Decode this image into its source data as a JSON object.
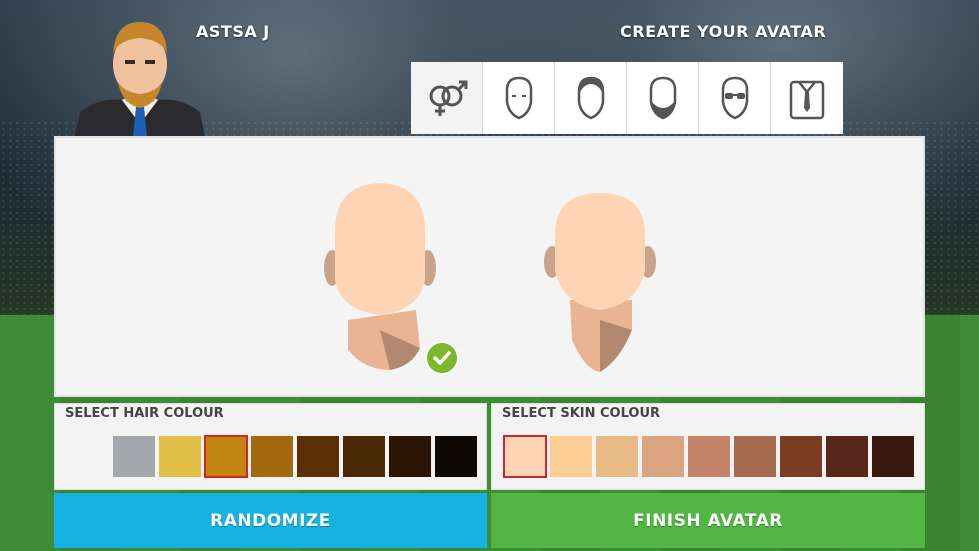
{
  "header": {
    "player_name": "ASTSA J",
    "title": "CREATE YOUR AVATAR"
  },
  "tabs": [
    {
      "icon": "gender-icon"
    },
    {
      "icon": "face-shape-icon"
    },
    {
      "icon": "hair-icon"
    },
    {
      "icon": "beard-icon"
    },
    {
      "icon": "glasses-icon"
    },
    {
      "icon": "shirt-tie-icon"
    }
  ],
  "hair_panel": {
    "title": "SELECT HAIR COLOUR",
    "selected_index": 3,
    "colors": [
      "#f3f3f3",
      "#a4a7ab",
      "#e2bf46",
      "#c2850f",
      "#a4680f",
      "#5b3006",
      "#4a2806",
      "#2c1505",
      "#0e0904"
    ]
  },
  "skin_panel": {
    "title": "SELECT SKIN COLOUR",
    "selected_index": 0,
    "colors": [
      "#fdd5b6",
      "#fccd94",
      "#e8bb86",
      "#dba581",
      "#c5846a",
      "#a66b4f",
      "#7a3c23",
      "#58261a",
      "#3a1a10"
    ]
  },
  "buttons": {
    "randomize": "RANDOMIZE",
    "finish": "FINISH AVATAR"
  },
  "colors": {
    "randomize_bg": "#16b2e4",
    "finish_bg": "#51b644",
    "check_green": "#7bb82c",
    "selection_red": "#d8232a"
  }
}
